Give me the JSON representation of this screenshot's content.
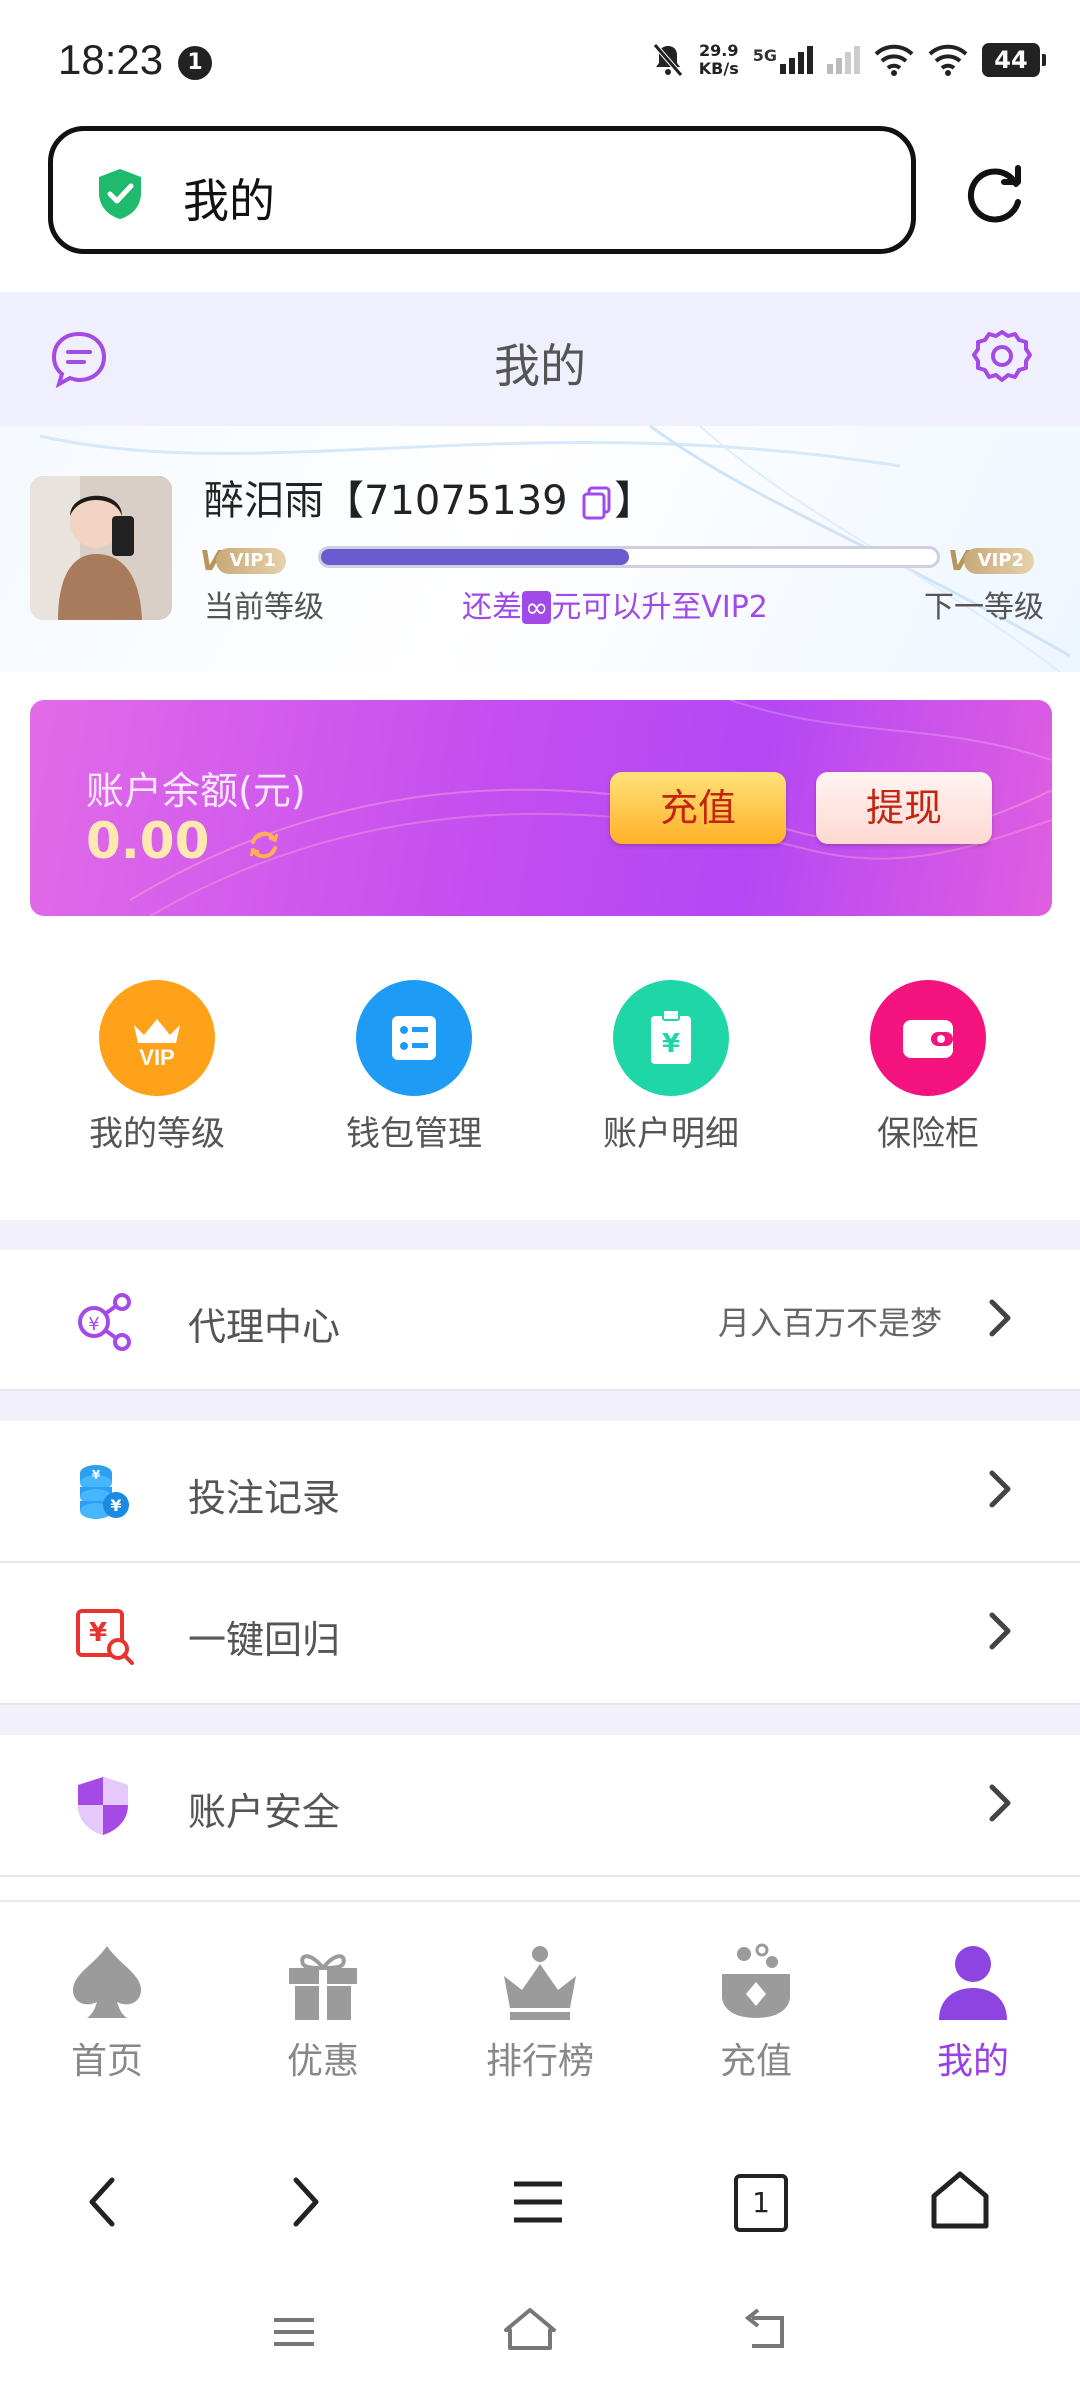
{
  "status_bar": {
    "time": "18:23",
    "notification_count": "1",
    "net_speed": "29.9",
    "net_unit": "KB/s",
    "network": "5G",
    "battery": "44"
  },
  "browser": {
    "url_title": "我的"
  },
  "header": {
    "title": "我的"
  },
  "profile": {
    "name": "醉汨雨【71075139",
    "name_suffix": "】",
    "current_vip": "VIP1",
    "next_vip": "VIP2",
    "progress": 0.5,
    "current_level_label": "当前等级",
    "upgrade_prefix": "还差",
    "upgrade_infinity": "∞",
    "upgrade_suffix": "元可以升至VIP2",
    "next_level_label": "下一等级"
  },
  "balance": {
    "label": "账户余额(元)",
    "value": "0.00",
    "recharge_label": "充值",
    "withdraw_label": "提现"
  },
  "quick_actions": [
    {
      "label": "我的等级",
      "icon": "vip-crown-icon",
      "color": "#ffa21a"
    },
    {
      "label": "钱包管理",
      "icon": "wallet-manage-icon",
      "color": "#1e9cf5"
    },
    {
      "label": "账户明细",
      "icon": "account-detail-icon",
      "color": "#1fd6a6"
    },
    {
      "label": "保险柜",
      "icon": "safe-box-icon",
      "color": "#f5137f"
    }
  ],
  "menu": [
    {
      "label": "代理中心",
      "hint": "月入百万不是梦",
      "icon": "agent-share-icon"
    },
    {
      "label": "投注记录",
      "hint": "",
      "icon": "coin-stack-icon"
    },
    {
      "label": "一键回归",
      "hint": "",
      "icon": "recycle-money-icon"
    },
    {
      "label": "账户安全",
      "hint": "",
      "icon": "shield-icon"
    }
  ],
  "tabs": [
    {
      "label": "首页",
      "icon": "spade-icon"
    },
    {
      "label": "优惠",
      "icon": "gift-icon"
    },
    {
      "label": "排行榜",
      "icon": "crown-icon"
    },
    {
      "label": "充值",
      "icon": "treasure-icon"
    },
    {
      "label": "我的",
      "icon": "user-icon"
    }
  ],
  "browser_nav": {
    "tab_count": "1"
  },
  "colors": {
    "accent": "#9a3fe6",
    "header_bg": "#f0effd",
    "card_gradient_start": "#e26be8",
    "card_gradient_end": "#b548f4"
  }
}
